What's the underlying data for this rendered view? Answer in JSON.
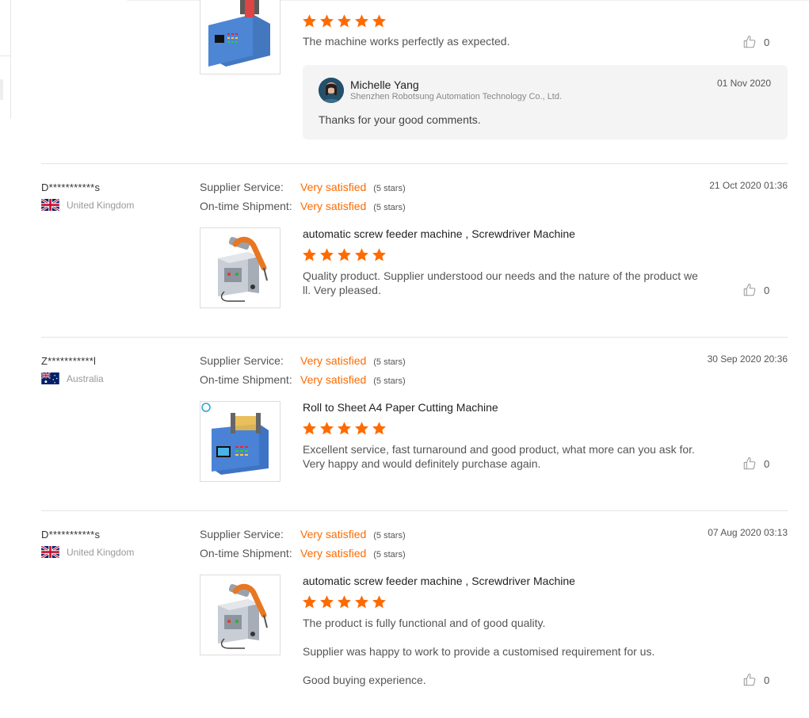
{
  "colors": {
    "accent": "#ff6a00",
    "divider": "#e3e3e3",
    "reply_bg": "#f4f4f4"
  },
  "top_review": {
    "rating": 5,
    "text": "The machine works perfectly as expected.",
    "likes": "0",
    "reply": {
      "name": "Michelle Yang",
      "company": "Shenzhen Robotsung Automation Technology Co., Ltd.",
      "date": "01 Nov 2020",
      "text": "Thanks for your good comments."
    }
  },
  "reviews": [
    {
      "buyer": "D***********s",
      "country": "United Kingdom",
      "flag": "uk-flag",
      "date": "21 Oct 2020 01:36",
      "supplier_service_label": "Supplier Service:",
      "supplier_service_value": "Very satisfied",
      "supplier_service_stars": "(5 stars)",
      "shipment_label": "On-time Shipment:",
      "shipment_value": "Very satisfied",
      "shipment_stars": "(5 stars)",
      "product": "automatic screw feeder machine , Screwdriver Machine",
      "rating": 5,
      "paragraphs": [
        "Quality product. Supplier understood our needs and the nature of the product well. Very pleased."
      ],
      "likes": "0"
    },
    {
      "buyer": "Z***********l",
      "country": "Australia",
      "flag": "australia-flag",
      "date": "30 Sep 2020 20:36",
      "supplier_service_label": "Supplier Service:",
      "supplier_service_value": "Very satisfied",
      "supplier_service_stars": "(5 stars)",
      "shipment_label": "On-time Shipment:",
      "shipment_value": "Very satisfied",
      "shipment_stars": "(5 stars)",
      "product": "Roll to Sheet A4 Paper Cutting Machine",
      "rating": 5,
      "paragraphs": [
        "Excellent service, fast turnaround and good product, what more can you ask for. Very happy and would definitely purchase again."
      ],
      "likes": "0"
    },
    {
      "buyer": "D***********s",
      "country": "United Kingdom",
      "flag": "uk-flag",
      "date": "07 Aug 2020 03:13",
      "supplier_service_label": "Supplier Service:",
      "supplier_service_value": "Very satisfied",
      "supplier_service_stars": "(5 stars)",
      "shipment_label": "On-time Shipment:",
      "shipment_value": "Very satisfied",
      "shipment_stars": "(5 stars)",
      "product": "automatic screw feeder machine , Screwdriver Machine",
      "rating": 5,
      "paragraphs": [
        "The product is fully functional and of good quality.",
        "Supplier was happy to work to provide a customised requirement for us.",
        "Good buying experience."
      ],
      "likes": "0"
    }
  ]
}
